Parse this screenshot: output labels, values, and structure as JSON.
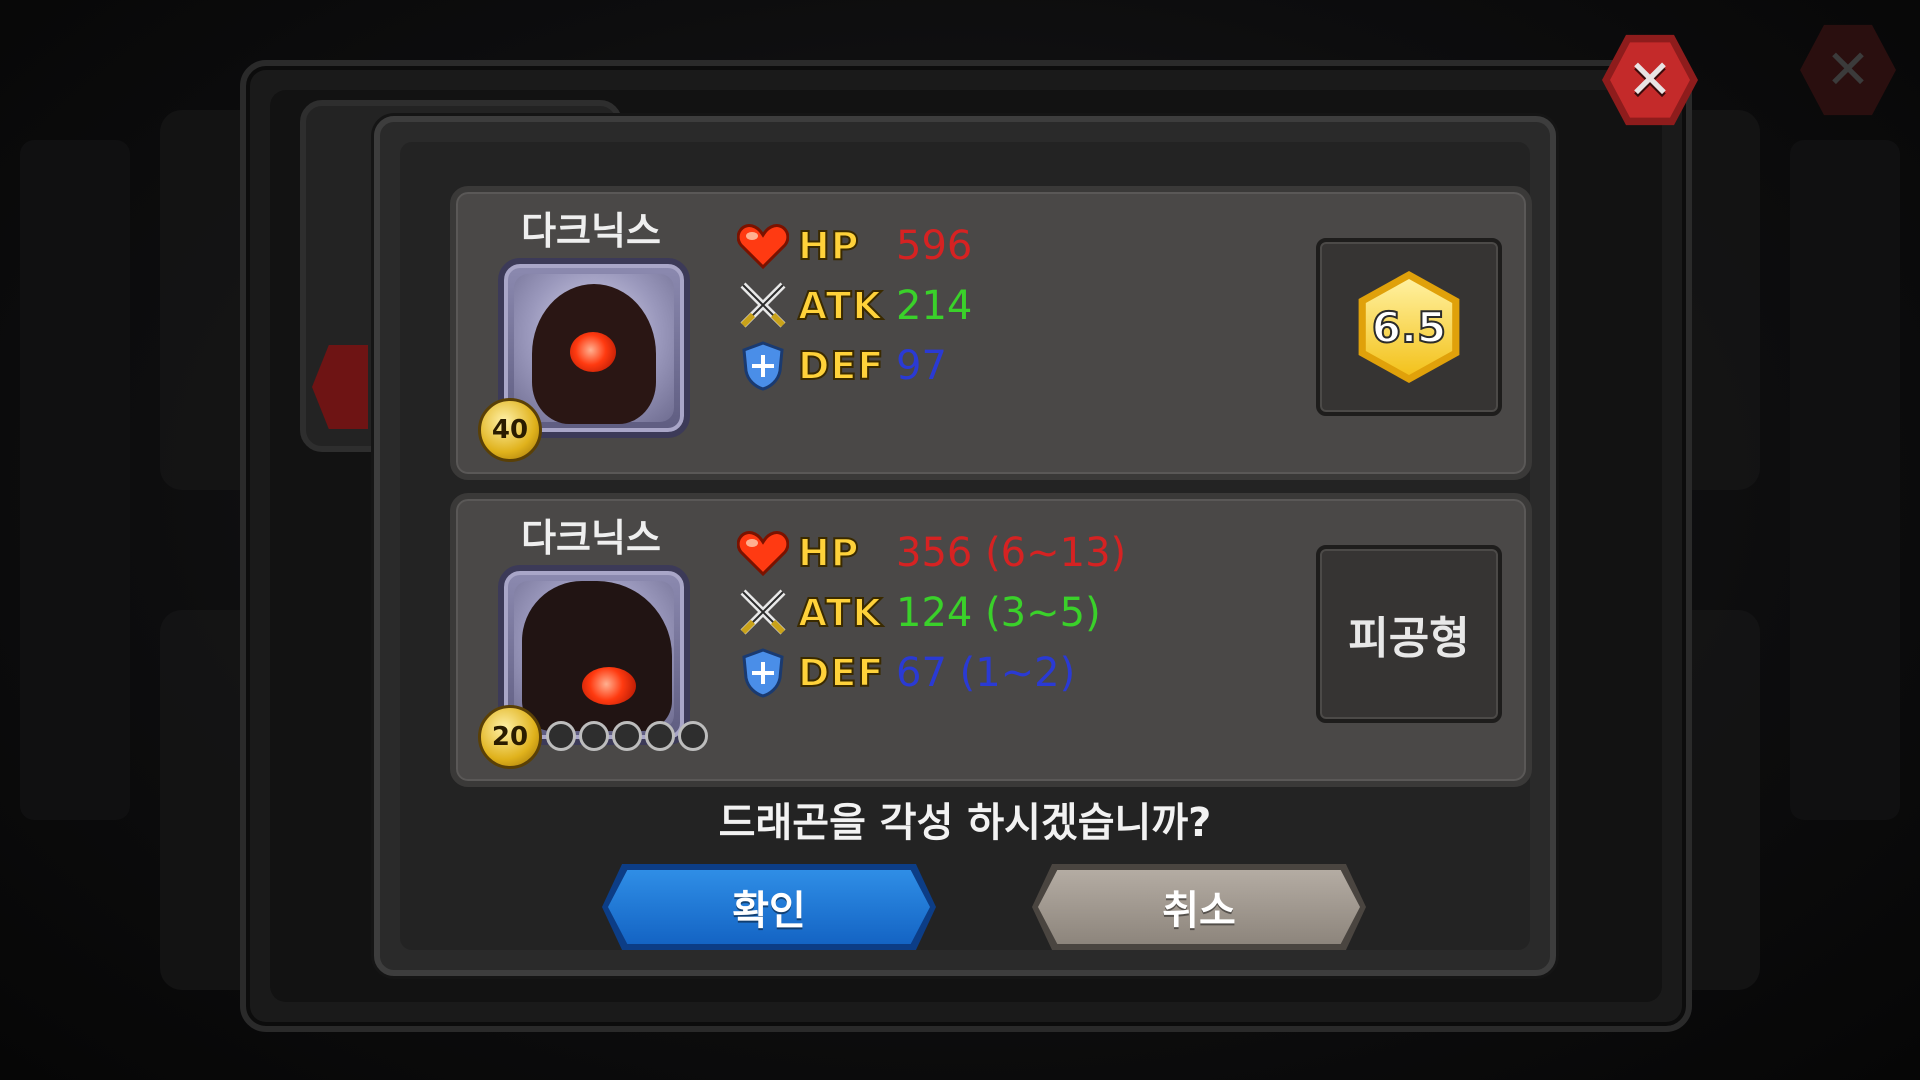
{
  "current": {
    "name": "다크닉스",
    "level": "40",
    "hp_label": "HP",
    "hp_value": "596",
    "atk_label": "ATK",
    "atk_value": "214",
    "def_label": "DEF",
    "def_value": "97",
    "grade": "6.5"
  },
  "awakened": {
    "name": "다크닉스",
    "level": "20",
    "stars": 0,
    "star_slots": 5,
    "hp_label": "HP",
    "hp_value": "356 (6~13)",
    "atk_label": "ATK",
    "atk_value": "124 (3~5)",
    "def_label": "DEF",
    "def_value": "67 (1~2)",
    "type": "피공형"
  },
  "dialog": {
    "question": "드래곤을 각성 하시겠습니까?",
    "confirm_label": "확인",
    "cancel_label": "취소"
  },
  "colors": {
    "hp": "#d62222",
    "atk": "#3ad12a",
    "def": "#2a3ad4",
    "confirm_button": "#1464c4",
    "cancel_button": "#8d857c",
    "close_button": "#c42a2a"
  },
  "icons": {
    "close": "close-icon",
    "hp": "heart-icon",
    "atk": "crossed-swords-icon",
    "def": "shield-icon"
  }
}
